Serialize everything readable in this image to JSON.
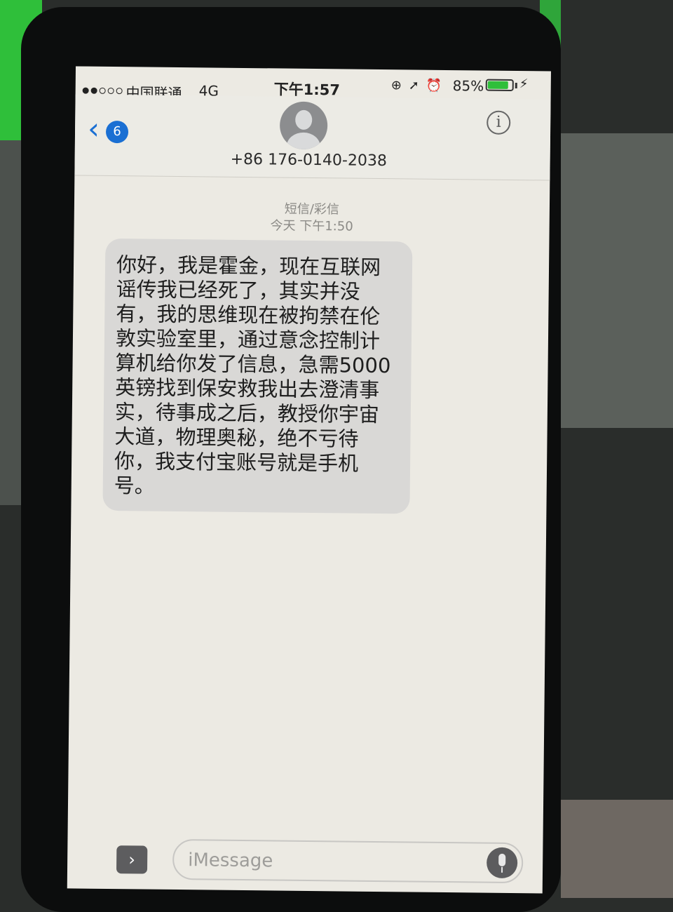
{
  "status_bar": {
    "carrier": "中国联通",
    "network": "4G",
    "time": "下午1:57",
    "battery_percent": "85%",
    "battery_level": 0.85,
    "signal_bars_on": 2,
    "signal_bars_total": 5
  },
  "header": {
    "back_badge": "6",
    "contact_number": "+86 176-0140-2038",
    "info_icon": "i"
  },
  "thread": {
    "message_type": "短信/彩信",
    "timestamp": "今天 下午1:50",
    "messages": [
      {
        "direction": "incoming",
        "text": "你好，我是霍金，现在互联网谣传我已经死了，其实并没有，我的思维现在被拘禁在伦敦实验室里，通过意念控制计算机给你发了信息，急需5000英镑找到保安救我出去澄清事实，待事成之后，教授你宇宙大道，物理奥秘，绝不亏待你，我支付宝账号就是手机号。"
      }
    ]
  },
  "input_bar": {
    "placeholder": "iMessage",
    "app_button": "›"
  },
  "colors": {
    "accent": "#1a6fd3",
    "bubble_incoming": "#d9d8d6",
    "screen_bg": "#eceae3",
    "battery_fill": "#2fbf3a"
  }
}
